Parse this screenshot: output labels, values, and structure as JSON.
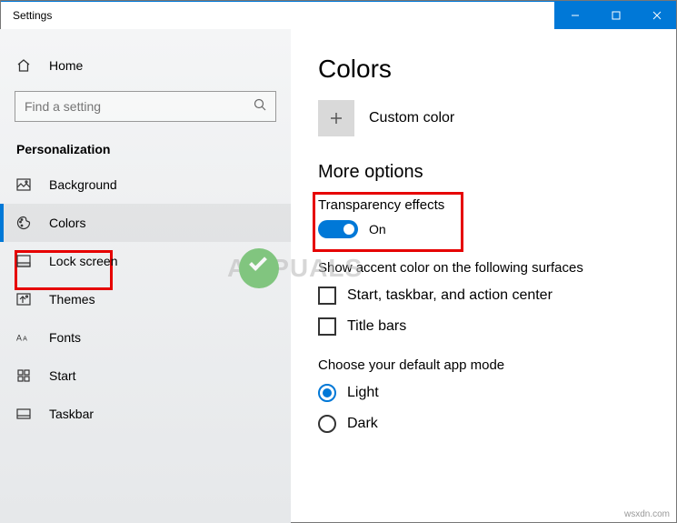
{
  "window": {
    "title": "Settings"
  },
  "sidebar": {
    "home": "Home",
    "search_placeholder": "Find a setting",
    "category": "Personalization",
    "items": [
      {
        "label": "Background"
      },
      {
        "label": "Colors"
      },
      {
        "label": "Lock screen"
      },
      {
        "label": "Themes"
      },
      {
        "label": "Fonts"
      },
      {
        "label": "Start"
      },
      {
        "label": "Taskbar"
      }
    ]
  },
  "main": {
    "title": "Colors",
    "custom_color": "Custom color",
    "more_options": "More options",
    "transparency": {
      "label": "Transparency effects",
      "state": "On"
    },
    "accent_label": "Show accent color on the following surfaces",
    "accent_options": [
      "Start, taskbar, and action center",
      "Title bars"
    ],
    "app_mode_label": "Choose your default app mode",
    "app_modes": [
      "Light",
      "Dark"
    ]
  },
  "attrib": "wsxdn.com"
}
